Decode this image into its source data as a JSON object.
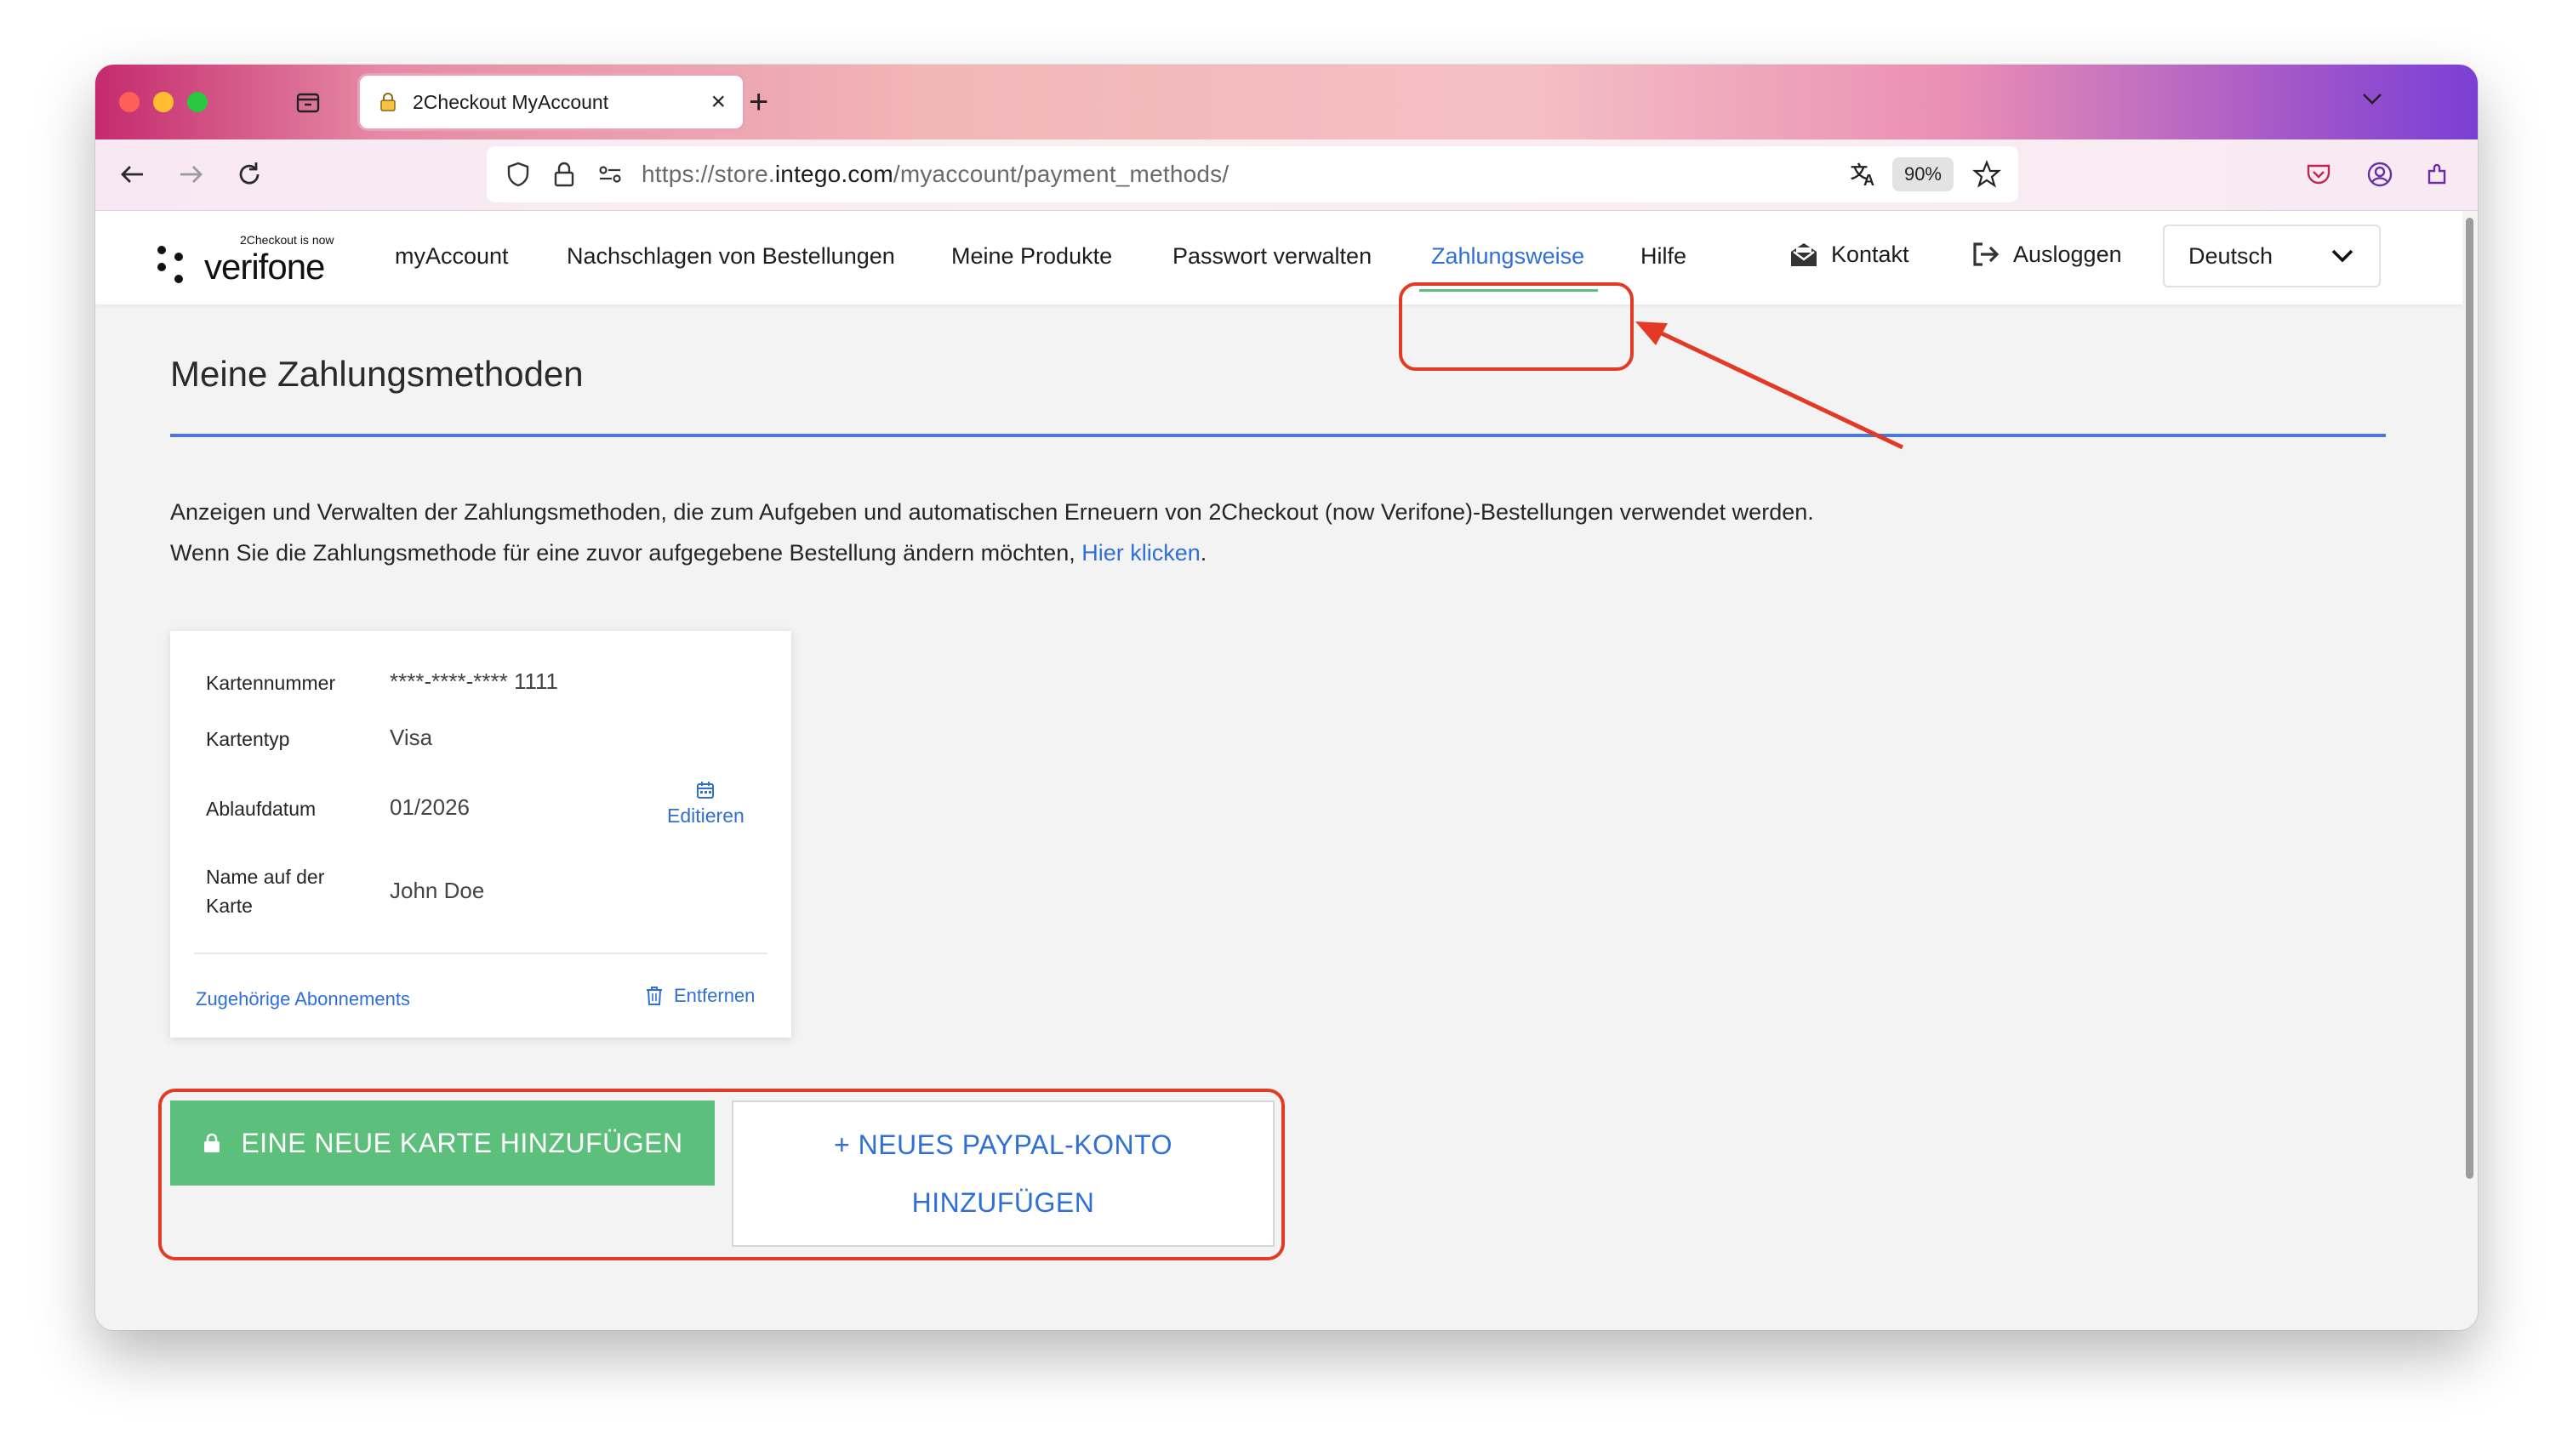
{
  "browser": {
    "tab_title": "2Checkout MyAccount",
    "tab_close": "×",
    "new_tab": "+",
    "url_prefix": "https://store.",
    "url_domain": "intego.com",
    "url_path": "/myaccount/payment_methods/",
    "zoom": "90%"
  },
  "header": {
    "logo_small": "2Checkout is now",
    "logo_big": "verifone",
    "nav": [
      {
        "label": "myAccount"
      },
      {
        "label": "Nachschlagen von Bestellungen"
      },
      {
        "label": "Meine Produkte"
      },
      {
        "label": "Passwort verwalten"
      },
      {
        "label": "Zahlungsweise",
        "active": true
      },
      {
        "label": "Hilfe"
      }
    ],
    "contact": "Kontakt",
    "logout": "Ausloggen",
    "language": "Deutsch"
  },
  "page": {
    "title": "Meine Zahlungsmethoden",
    "desc_line1": "Anzeigen und Verwalten der Zahlungsmethoden, die zum Aufgeben und automatischen Erneuern von 2Checkout (now Verifone)-Bestellungen verwendet werden.",
    "desc_line2": "Wenn Sie die Zahlungsmethode für eine zuvor aufgegebene Bestellung ändern möchten,",
    "desc_link": "Hier klicken",
    "desc_end": "."
  },
  "card": {
    "number_label": "Kartennummer",
    "number_value": "****-****-**** 1111",
    "type_label": "Kartentyp",
    "type_value": "Visa",
    "expiry_label": "Ablaufdatum",
    "expiry_value": "01/2026",
    "edit_label": "Editieren",
    "name_label_1": "Name auf der",
    "name_label_2": "Karte",
    "name_value": "John Doe",
    "subscriptions_link": "Zugehörige Abonnements",
    "remove_link": "Entfernen"
  },
  "actions": {
    "add_card": "EINE NEUE KARTE HINZUFÜGEN",
    "add_paypal_1": "+  NEUES PAYPAL-KONTO",
    "add_paypal_2": "HINZUFÜGEN"
  },
  "colors": {
    "accent_blue": "#2f6fd6",
    "green": "#5cbf7b",
    "highlight_red": "#e23a25"
  }
}
